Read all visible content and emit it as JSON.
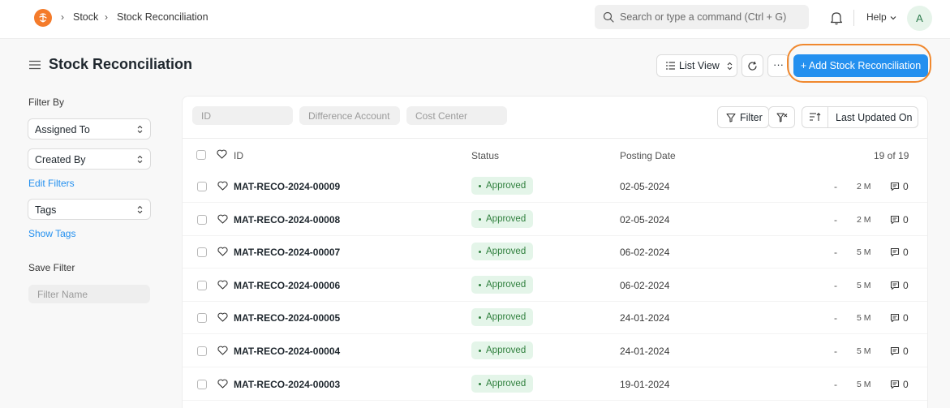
{
  "navbar": {
    "breadcrumbs": [
      "Stock",
      "Stock Reconciliation"
    ],
    "search_placeholder": "Search or type a command (Ctrl + G)",
    "help_label": "Help",
    "avatar_initial": "A"
  },
  "page": {
    "title": "Stock Reconciliation",
    "list_view_label": "List View",
    "more_label": "···",
    "primary_button": "+ Add Stock Reconciliation"
  },
  "sidebar": {
    "filter_by": "Filter By",
    "assigned_to": "Assigned To",
    "created_by": "Created By",
    "edit_filters": "Edit Filters",
    "tags": "Tags",
    "show_tags": "Show Tags",
    "save_filter": "Save Filter",
    "filter_name_placeholder": "Filter Name"
  },
  "filters": {
    "id_placeholder": "ID",
    "difference_account_placeholder": "Difference Account",
    "cost_center_placeholder": "Cost Center",
    "filter_label": "Filter",
    "sort_label": "Last Updated On"
  },
  "table": {
    "headers": {
      "id": "ID",
      "status": "Status",
      "posting_date": "Posting Date"
    },
    "count": "19 of 19",
    "rows": [
      {
        "id": "MAT-RECO-2024-00009",
        "status": "Approved",
        "date": "02-05-2024",
        "dash": "-",
        "modified": "2 M",
        "comments": "0"
      },
      {
        "id": "MAT-RECO-2024-00008",
        "status": "Approved",
        "date": "02-05-2024",
        "dash": "-",
        "modified": "2 M",
        "comments": "0"
      },
      {
        "id": "MAT-RECO-2024-00007",
        "status": "Approved",
        "date": "06-02-2024",
        "dash": "-",
        "modified": "5 M",
        "comments": "0"
      },
      {
        "id": "MAT-RECO-2024-00006",
        "status": "Approved",
        "date": "06-02-2024",
        "dash": "-",
        "modified": "5 M",
        "comments": "0"
      },
      {
        "id": "MAT-RECO-2024-00005",
        "status": "Approved",
        "date": "24-01-2024",
        "dash": "-",
        "modified": "5 M",
        "comments": "0"
      },
      {
        "id": "MAT-RECO-2024-00004",
        "status": "Approved",
        "date": "24-01-2024",
        "dash": "-",
        "modified": "5 M",
        "comments": "0"
      },
      {
        "id": "MAT-RECO-2024-00003",
        "status": "Approved",
        "date": "19-01-2024",
        "dash": "-",
        "modified": "5 M",
        "comments": "0"
      }
    ]
  },
  "colors": {
    "primary": "#2490ef",
    "approved_bg": "#e4f5e9",
    "approved_text": "#30803e",
    "highlight": "#f0882e",
    "logo": "#f47b2b"
  }
}
